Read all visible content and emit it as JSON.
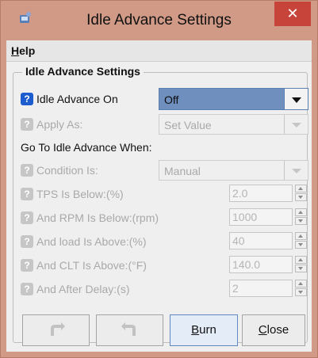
{
  "window": {
    "title": "Idle Advance Settings",
    "close_symbol": "✕"
  },
  "menu": {
    "help": {
      "mnemonic": "H",
      "rest": "elp"
    }
  },
  "group": {
    "legend": "Idle Advance Settings"
  },
  "fields": {
    "idle_advance_on": {
      "label": "Idle Advance On",
      "value": "Off",
      "enabled": true
    },
    "apply_as": {
      "label": "Apply As:",
      "value": "Set Value",
      "enabled": false
    },
    "section_label": "Go To Idle Advance When:",
    "condition_is": {
      "label": "Condition Is:",
      "value": "Manual",
      "enabled": false
    },
    "tps_below": {
      "label": "TPS Is Below:(%)",
      "value": "2.0",
      "enabled": false
    },
    "rpm_below": {
      "label": "And RPM Is Below:(rpm)",
      "value": "1000",
      "enabled": false
    },
    "load_above": {
      "label": "And load Is Above:(%)",
      "value": "40",
      "enabled": false
    },
    "clt_above": {
      "label": "And CLT Is Above:(°F)",
      "value": "140.0",
      "enabled": false
    },
    "after_delay": {
      "label": "And After Delay:(s)",
      "value": "2",
      "enabled": false
    }
  },
  "help_glyph": "?",
  "buttons": {
    "undo": {
      "icon": "undo-icon",
      "enabled": false
    },
    "redo": {
      "icon": "redo-icon",
      "enabled": false
    },
    "burn": {
      "mnemonic": "B",
      "rest": "urn"
    },
    "close": {
      "mnemonic": "C",
      "rest": "lose"
    }
  },
  "colors": {
    "title_bar": "#d09a86",
    "close_button": "#c7443a",
    "help_icon_active": "#1d5ccf",
    "combo_active": "#6f8fbf"
  }
}
